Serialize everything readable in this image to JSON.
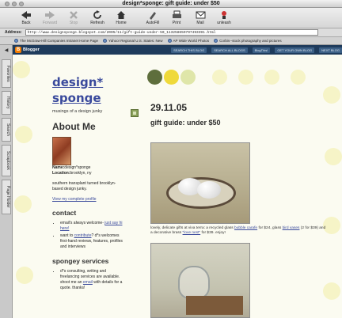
{
  "window": {
    "title": "design*sponge: gift guide: under $50"
  },
  "toolbar": {
    "buttons": [
      {
        "label": "Back",
        "icon": "back-arrow-icon",
        "enabled": true
      },
      {
        "label": "Forward",
        "icon": "forward-arrow-icon",
        "enabled": false
      },
      {
        "label": "Stop",
        "icon": "stop-icon",
        "enabled": false
      },
      {
        "label": "Refresh",
        "icon": "refresh-icon",
        "enabled": true
      },
      {
        "label": "Home",
        "icon": "home-icon",
        "enabled": true
      },
      {
        "label": "AutoFill",
        "icon": "autofill-icon",
        "enabled": true
      },
      {
        "label": "Print",
        "icon": "print-icon",
        "enabled": true
      },
      {
        "label": "Mail",
        "icon": "mail-icon",
        "enabled": true
      },
      {
        "label": "unleash",
        "icon": "unleash-icon",
        "enabled": true
      }
    ]
  },
  "address": {
    "label": "Address:",
    "url": "http://www.designsponge.blogspot.com/2005/11/gift-guide-under-50_113258659797493391.html"
  },
  "favorites": [
    "The McGraw-Hill Companies Intranet Home Page",
    "Yahoo! Regional U.S. States: New",
    "AP Wide World Photos",
    "Corbis--stock photography and pictures"
  ],
  "explorer_tabs": [
    "Favorites",
    "History",
    "Search",
    "Scrapbook",
    "Page Holder"
  ],
  "blogger_bar": {
    "logo_text": "Blogger",
    "buttons": [
      "SEARCH THIS BLOG",
      "SEARCH ALL BLOGS",
      "BlogThis!",
      "GET YOUR OWN BLOG",
      "NEXT BLOG"
    ]
  },
  "blog": {
    "title_line1": "design*",
    "title_line2": "sponge",
    "tagline": "musings of a design junky",
    "about_heading": "About Me",
    "profile_name_label": "Name:",
    "profile_name": "design*sponge",
    "profile_location_label": "Location:",
    "profile_location": "brooklyn, ny",
    "profile_description": "southern transplant turned brooklyn-based design junky.",
    "profile_link": "View my complete profile",
    "contact_heading": "contact",
    "contact_items": [
      {
        "before": "email's always welcome- ",
        "link": "just say hi here!",
        "after": ""
      },
      {
        "before": "want to ",
        "link": "contribute",
        "after": "? d*s welcomes first-hand reviews, features, profiles and interviews"
      }
    ],
    "services_heading": "spongey services",
    "services_items": [
      {
        "before": "d*s consulting, writing and freelancing services are available. shoot me an ",
        "link": "email",
        "after": " with details for a quote. thanks!"
      }
    ]
  },
  "post": {
    "date": "29.11.05",
    "title": "gift guide: under $50",
    "caption_part1": "lovely, delicate gifts at viva terra: a recycled glass ",
    "caption_link1": "bubble carafe",
    "caption_part2": " for $24, glass ",
    "caption_link2": "bird vases",
    "caption_part3": " (2 for $39) and a decorative brass ",
    "caption_link3": "\"love nest\"",
    "caption_part4": " for $39. enjoy!"
  },
  "colors": {
    "accent_dot_green": "#5e6e3c",
    "accent_dot_yellow": "#efd93a",
    "accent_dot_pale": "#dfe6a9",
    "link_blue": "#3a4a9c",
    "blogger_bar": "#1e3b5c",
    "page_background": "#fbfbf1"
  }
}
